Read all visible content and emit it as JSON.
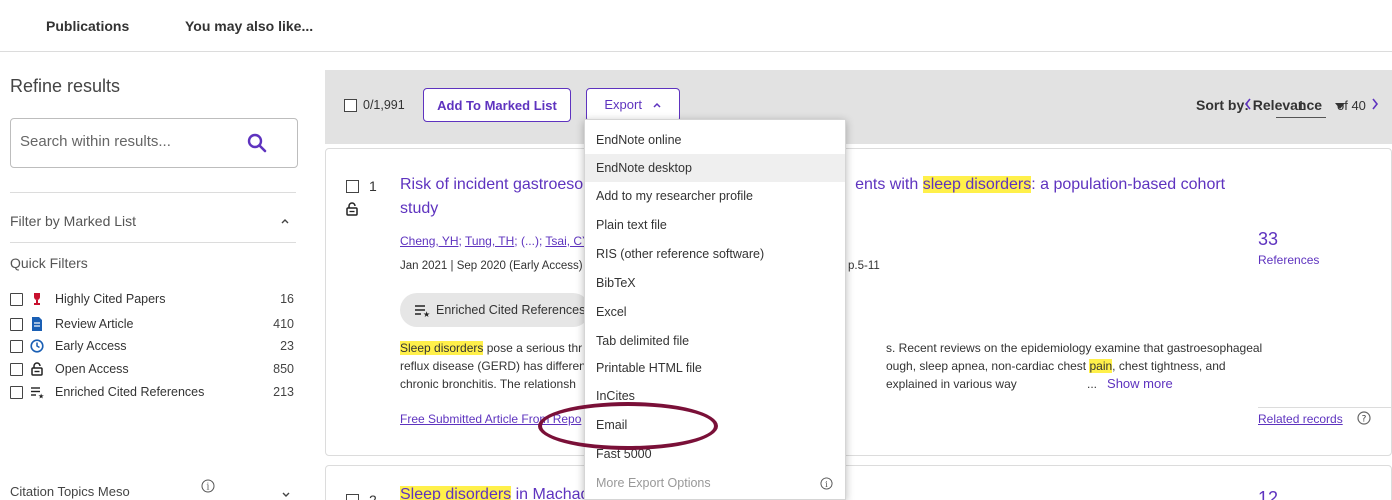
{
  "topnav": {
    "tabs": [
      "Publications",
      "You may also like..."
    ]
  },
  "sidebar": {
    "title": "Refine results",
    "search_placeholder": "Search within results...",
    "filter_marked_list": "Filter by Marked List",
    "quick_filters_label": "Quick Filters",
    "quick_filters": [
      {
        "label": "Highly Cited Papers",
        "count": "16",
        "icon": "trophy-icon"
      },
      {
        "label": "Review Article",
        "count": "410",
        "icon": "document-icon"
      },
      {
        "label": "Early Access",
        "count": "23",
        "icon": "clock-icon"
      },
      {
        "label": "Open Access",
        "count": "850",
        "icon": "unlock-icon"
      },
      {
        "label": "Enriched Cited References",
        "count": "213",
        "icon": "enriched-icon"
      }
    ],
    "citation_topics": "Citation Topics Meso"
  },
  "toolbar": {
    "selected_count": "0/1,991",
    "add_marked_list": "Add To Marked List",
    "export_label": "Export",
    "sort_label": "Sort by: Relevance",
    "page_current": "1",
    "page_total": "of 40"
  },
  "record1": {
    "number": "1",
    "title_part1": "Risk of incident gastroesop",
    "title_part2": "ents with ",
    "title_highlight": "sleep disorders",
    "title_part3": ": a population-based cohort",
    "title_line2": "study",
    "authors": [
      "Cheng, YH",
      "Tung, TH",
      "Tsai, CY"
    ],
    "authors_ellipsis": "(...)",
    "dates": "Jan 2021 | Sep 2020 (Early Access)",
    "pages": "p.5-11",
    "enriched_label": "Enriched Cited References",
    "abstract": {
      "l1_hl": "Sleep disorders",
      "l1_a": " pose a serious thr",
      "l1_b": "s. Recent reviews on the epidemiology examine that gastroesophageal",
      "l2_a": "reflux disease (GERD) has differen",
      "l2_b": "ough, sleep apnea, non-cardiac chest ",
      "l2_hl": "pain",
      "l2_c": ", chest tightness, and",
      "l3_a": "chronic bronchitis. The relationsh",
      "l3_b": "explained in various way",
      "l3_ellipsis": "...",
      "show_more": "Show more"
    },
    "free_link": "Free Submitted Article From Repo",
    "citations": "33",
    "citations_label": "References",
    "related": "Related records"
  },
  "record2": {
    "number": "2",
    "title_highlight": "Sleep disorders",
    "title_rest": " in Machad",
    "citations": "12"
  },
  "export_menu": {
    "items": [
      "EndNote online",
      "EndNote desktop",
      "Add to my researcher profile",
      "Plain text file",
      "RIS (other reference software)",
      "BibTeX",
      "Excel",
      "Tab delimited file",
      "Printable HTML file",
      "InCites",
      "Email",
      "Fast 5000",
      "More Export Options"
    ]
  },
  "colors": {
    "accent": "#5e33bf",
    "highlight": "#fff04a",
    "annotation": "#7a1038"
  }
}
